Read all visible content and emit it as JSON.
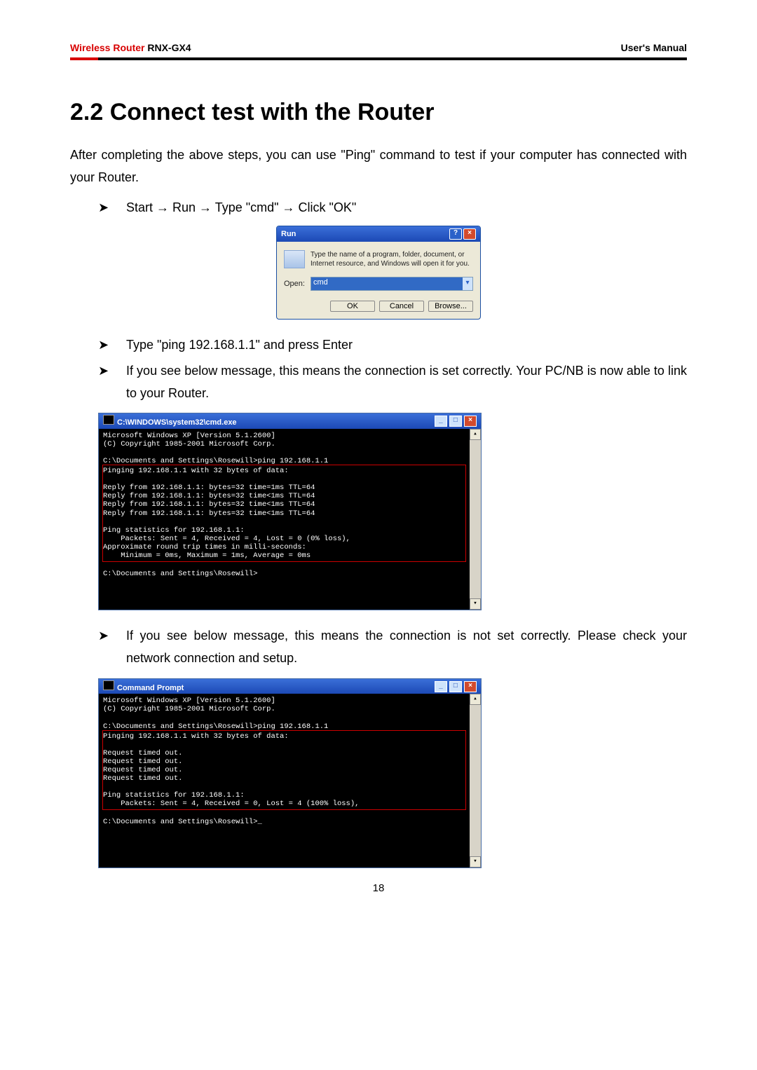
{
  "header": {
    "red": "Wireless Router",
    "model": " RNX-GX4",
    "right": "User's Manual"
  },
  "section_title": "2.2 Connect test with the Router",
  "intro": "After completing the above steps, you can use \"Ping\" command to test if your computer has connected with your Router.",
  "step1": "Start → Run → Type \"cmd\" → Click \"OK\"",
  "step2": "Type \"ping 192.168.1.1\" and press Enter",
  "step3": "If you see below message, this means the connection is set correctly. Your PC/NB is now able to link to your Router.",
  "step4": "If you see below message, this means the connection is not set correctly. Please check your network connection and setup.",
  "run": {
    "title": "Run",
    "desc": "Type the name of a program, folder, document, or Internet resource, and Windows will open it for you.",
    "open_label": "Open:",
    "value": "cmd",
    "ok": "OK",
    "cancel": "Cancel",
    "browse": "Browse..."
  },
  "cmd1": {
    "title": "C:\\WINDOWS\\system32\\cmd.exe",
    "pre": "Microsoft Windows XP [Version 5.1.2600]\n(C) Copyright 1985-2001 Microsoft Corp.\n\nC:\\Documents and Settings\\Rosewill>ping 192.168.1.1\n",
    "hl": "Pinging 192.168.1.1 with 32 bytes of data:\n\nReply from 192.168.1.1: bytes=32 time=1ms TTL=64\nReply from 192.168.1.1: bytes=32 time<1ms TTL=64\nReply from 192.168.1.1: bytes=32 time<1ms TTL=64\nReply from 192.168.1.1: bytes=32 time<1ms TTL=64\n\nPing statistics for 192.168.1.1:\n    Packets: Sent = 4, Received = 4, Lost = 0 (0% loss),\nApproximate round trip times in milli-seconds:\n    Minimum = 0ms, Maximum = 1ms, Average = 0ms",
    "post": "\nC:\\Documents and Settings\\Rosewill>"
  },
  "cmd2": {
    "title": "Command Prompt",
    "pre": "Microsoft Windows XP [Version 5.1.2600]\n(C) Copyright 1985-2001 Microsoft Corp.\n\nC:\\Documents and Settings\\Rosewill>ping 192.168.1.1\n",
    "hl": "Pinging 192.168.1.1 with 32 bytes of data:\n\nRequest timed out.\nRequest timed out.\nRequest timed out.\nRequest timed out.\n\nPing statistics for 192.168.1.1:\n    Packets: Sent = 4, Received = 0, Lost = 4 (100% loss),",
    "post": "\nC:\\Documents and Settings\\Rosewill>_"
  },
  "page_number": "18"
}
